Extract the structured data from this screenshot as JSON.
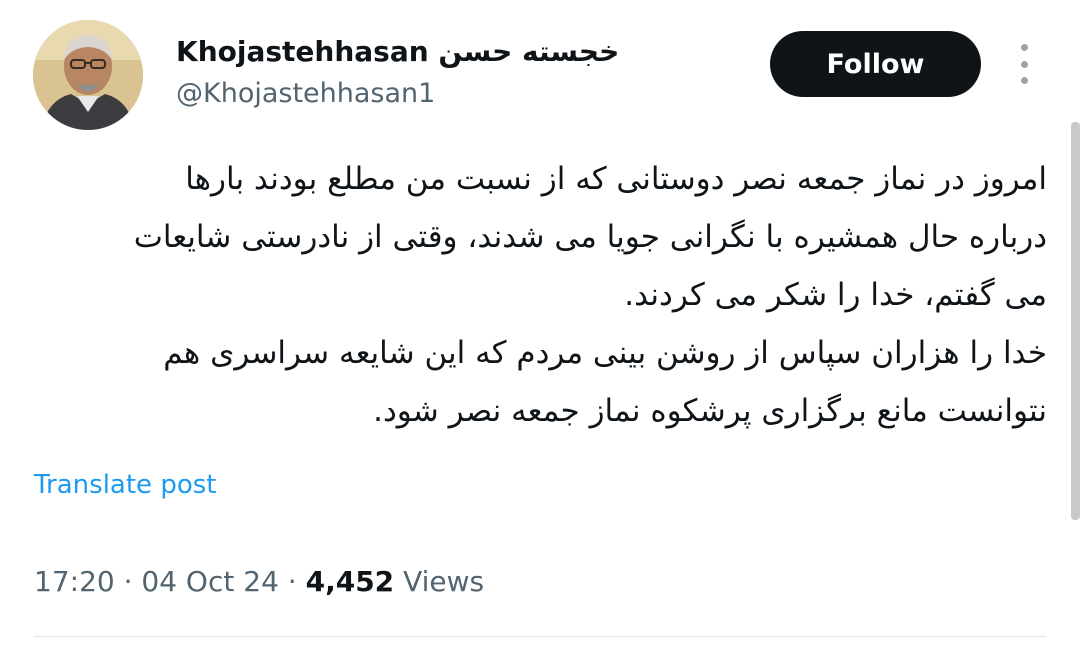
{
  "author": {
    "display_name": "Khojastehhasan خجسته حسن",
    "username": "@Khojastehhasan1",
    "avatar_alt": "profile photo"
  },
  "header": {
    "follow_label": "Follow",
    "more_icon": "more-vertical-icon"
  },
  "tweet": {
    "lines": [
      "امروز در نماز جمعه نصر دوستانی که از نسبت من مطلع بودند بارها",
      "درباره حال همشیره با نگرانی جویا می شدند، وقتی از نادرستی شایعات",
      "می گفتم، خدا را شکر می کردند.",
      "خدا را هزاران سپاس از روشن بینی مردم که این شایعه سراسری هم",
      "نتوانست مانع برگزاری پرشکوه  نماز جمعه نصر شود."
    ],
    "translate_label": "Translate post"
  },
  "meta": {
    "time": "17:20",
    "separator": " · ",
    "date": "04 Oct 24",
    "views_count": "4,452",
    "views_label": " Views"
  },
  "colors": {
    "follow_bg": "#0f1419",
    "link": "#1d9bf0",
    "muted": "#536471"
  }
}
